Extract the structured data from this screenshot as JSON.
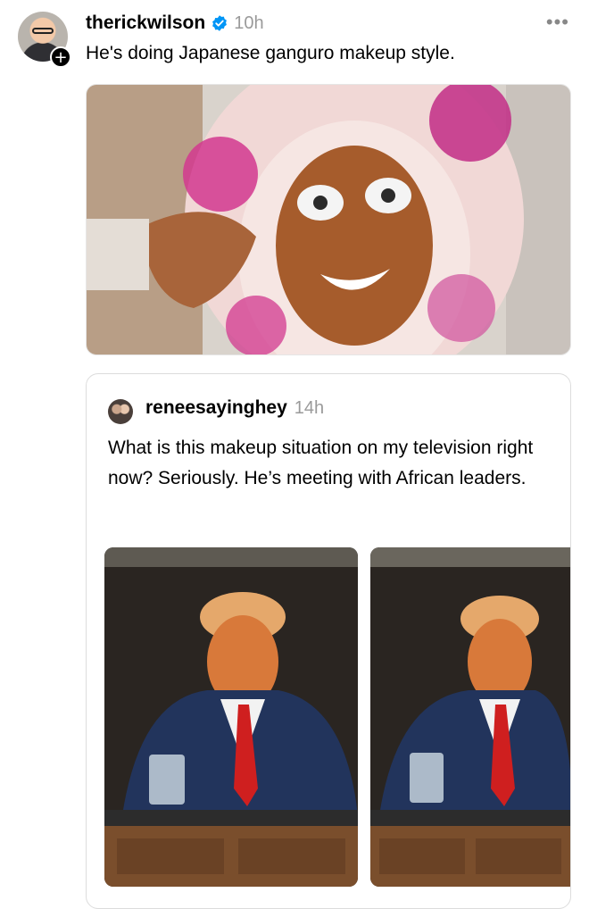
{
  "post": {
    "author": "therickwilson",
    "time": "10h",
    "text": "He's doing Japanese ganguro makeup style.",
    "more_icon": "ellipsis-icon",
    "follow_icon": "plus-icon"
  },
  "quoted_post": {
    "author": "reneesayinghey",
    "time": "14h",
    "text": "What is this makeup situation on my television right now? Seriously.  He’s meeting with African leaders."
  },
  "colors": {
    "verified": "#0095f6",
    "muted": "#9a9a9a",
    "border": "#dcdcdc"
  }
}
